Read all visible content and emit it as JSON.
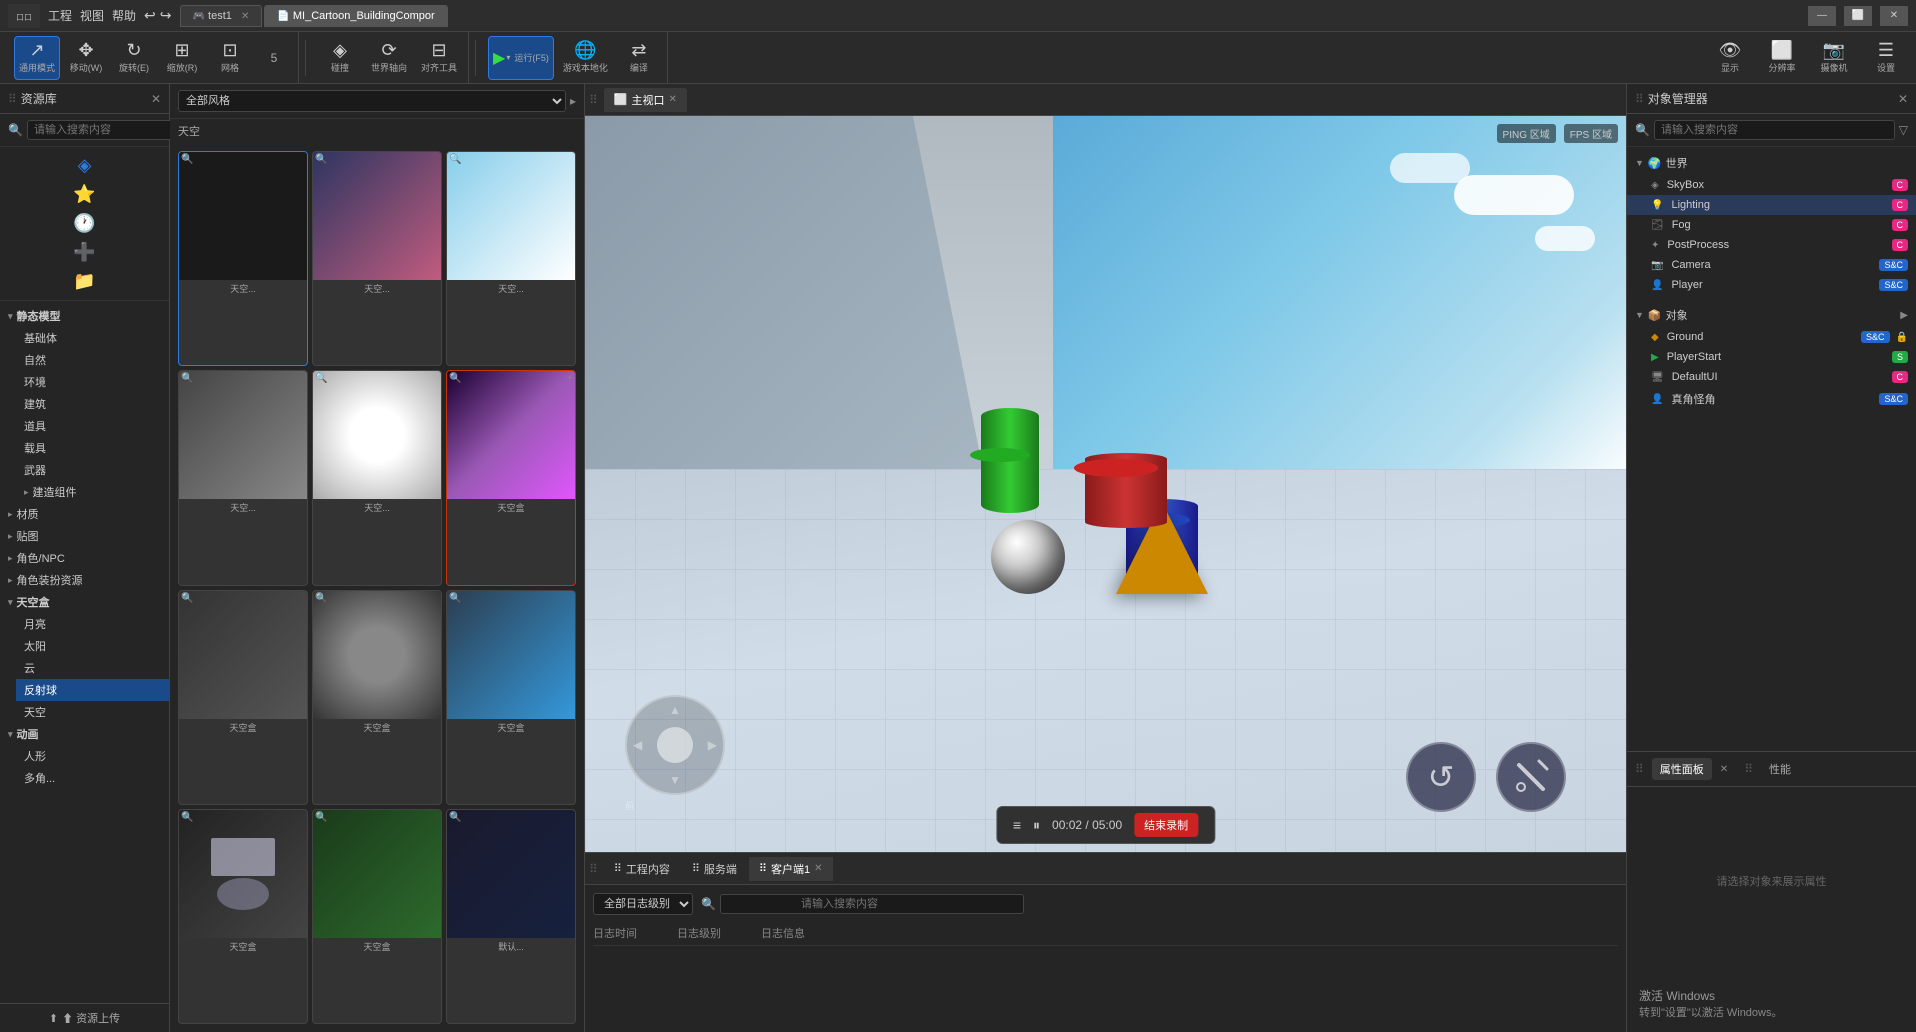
{
  "titlebar": {
    "logo": "LOGO",
    "tabs": [
      {
        "id": "tab1",
        "label": "test1",
        "icon": "🎮",
        "active": true
      },
      {
        "id": "tab2",
        "label": "MI_Cartoon_BuildingCompor",
        "icon": "📄",
        "active": false
      }
    ],
    "win_controls": [
      "—",
      "⬜",
      "✕"
    ]
  },
  "toolbar": {
    "groups": [
      {
        "items": [
          {
            "id": "mode",
            "icon": "↗",
            "label": "通用模式",
            "active": true
          },
          {
            "id": "move",
            "icon": "✥",
            "label": "移动(W)"
          },
          {
            "id": "rotate",
            "icon": "↻",
            "label": "旋转(E)"
          },
          {
            "id": "scale",
            "icon": "⊞",
            "label": "缩放(R)"
          },
          {
            "id": "grid",
            "icon": "⊡",
            "label": "网格"
          },
          {
            "id": "step",
            "icon": "5",
            "label": ""
          }
        ]
      },
      {
        "items": [
          {
            "id": "collision",
            "icon": "◈",
            "label": "碰撞"
          },
          {
            "id": "worldaxis",
            "icon": "⟳",
            "label": "世界轴向"
          },
          {
            "id": "align",
            "icon": "⊟",
            "label": "对齐工具"
          }
        ]
      },
      {
        "items": [
          {
            "id": "run",
            "icon": "▶",
            "label": "运行(F5)",
            "active": true,
            "hasArrow": true
          },
          {
            "id": "localize",
            "icon": "🌐",
            "label": "游戏本地化"
          },
          {
            "id": "translate",
            "icon": "⇄",
            "label": "编译"
          }
        ]
      }
    ],
    "right_controls": [
      {
        "id": "display",
        "label": "显示"
      },
      {
        "id": "resolution",
        "label": "分辨率"
      },
      {
        "id": "camera",
        "label": "摄像机"
      },
      {
        "id": "settings",
        "label": "设置"
      }
    ]
  },
  "menus": [
    "工程",
    "视图",
    "帮助"
  ],
  "asset_panel": {
    "title": "资源库",
    "search_placeholder": "请输入搜索内容",
    "style_options": [
      "全部风格"
    ],
    "category_label": "天空",
    "tree": [
      {
        "label": "静态模型",
        "expanded": true,
        "isCategory": true
      },
      {
        "label": "基础体",
        "indent": true
      },
      {
        "label": "自然",
        "indent": true
      },
      {
        "label": "环境",
        "indent": true
      },
      {
        "label": "建筑",
        "indent": true
      },
      {
        "label": "道具",
        "indent": true
      },
      {
        "label": "载具",
        "indent": true
      },
      {
        "label": "武器",
        "indent": true
      },
      {
        "label": "建造组件",
        "indent": true,
        "expandable": true
      },
      {
        "label": "材质",
        "isCategory": true,
        "expandable": true
      },
      {
        "label": "贴图",
        "isCategory": true,
        "expandable": true
      },
      {
        "label": "角色/NPC",
        "isCategory": true,
        "expandable": true
      },
      {
        "label": "角色装扮资源",
        "isCategory": true,
        "expandable": true
      },
      {
        "label": "天空盒",
        "isCategory": true,
        "expanded": true
      },
      {
        "label": "月亮",
        "indent": true
      },
      {
        "label": "太阳",
        "indent": true
      },
      {
        "label": "云",
        "indent": true
      },
      {
        "label": "反射球",
        "indent": true,
        "active": true
      },
      {
        "label": "天空",
        "indent": true
      },
      {
        "label": "动画",
        "isCategory": true,
        "expanded": true
      },
      {
        "label": "人形",
        "indent": true
      },
      {
        "label": "多角...",
        "indent": true
      }
    ],
    "upload_label": "⬆ 资源上传",
    "thumbnails": [
      {
        "label": "天空...",
        "style": "sky-thumb-selected",
        "selected": true
      },
      {
        "label": "天空...",
        "style": "sky-thumb-2"
      },
      {
        "label": "天空...",
        "style": "sky-thumb-3"
      },
      {
        "label": "天空...",
        "style": "sky-thumb-4"
      },
      {
        "label": "天空...",
        "style": "sky-thumb-5"
      },
      {
        "label": "天空盒",
        "style": "sky-thumb-special"
      },
      {
        "label": "天空盒",
        "style": "sky-thumb-4"
      },
      {
        "label": "天空盒",
        "style": "sky-thumb-5"
      },
      {
        "label": "天空盒",
        "style": "sky-thumb-3"
      },
      {
        "label": "天空盒",
        "style": "sky-thumb-2"
      },
      {
        "label": "天空盒",
        "style": "sky-thumb-6"
      },
      {
        "label": "默认...",
        "style": "sky-thumb-1"
      }
    ]
  },
  "viewport": {
    "tab_label": "主视口",
    "ping_label": "PING 区域",
    "fps_label": "FPS 区域",
    "joystick_arrows": "↑↓←→",
    "action_btns": [
      "↺",
      "⚔"
    ]
  },
  "bottom_panel": {
    "tabs": [
      {
        "label": "工程内容",
        "active": false
      },
      {
        "label": "服务端",
        "active": false
      },
      {
        "label": "客户端1",
        "active": true,
        "closable": true
      }
    ],
    "log_filter": "全部日志级别",
    "search_placeholder": "请输入搜索内容",
    "headers": [
      "日志时间",
      "日志级别",
      "日志信息"
    ],
    "recording": {
      "time": "00:02 / 05:00",
      "stop_label": "结束录制"
    }
  },
  "object_manager": {
    "title": "对象管理器",
    "search_placeholder": "请输入搜索内容",
    "world_label": "世界",
    "object_label": "对象",
    "world_items": [
      {
        "label": "SkyBox",
        "badge": "C",
        "badge_type": "badge-c"
      },
      {
        "label": "Lighting",
        "badge": "C",
        "badge_type": "badge-c"
      },
      {
        "label": "Fog",
        "badge": "C",
        "badge_type": "badge-c"
      },
      {
        "label": "PostProcess",
        "badge": "C",
        "badge_type": "badge-c"
      },
      {
        "label": "Camera",
        "badge": "S&C",
        "badge_type": "badge-sc"
      },
      {
        "label": "Player",
        "badge": "S&C",
        "badge_type": "badge-sc"
      }
    ],
    "object_items": [
      {
        "label": "Ground",
        "badge": "S&C",
        "badge_type": "badge-sc",
        "hasLock": true
      },
      {
        "label": "PlayerStart",
        "badge": "S",
        "badge_type": "badge-s"
      },
      {
        "label": "DefaultUI",
        "badge": "C",
        "badge_type": "badge-c"
      },
      {
        "label": "真角怪角",
        "badge": "S&C",
        "badge_type": "badge-sc"
      }
    ]
  },
  "properties_panel": {
    "title": "属性面板",
    "tabs": [
      "属性面板",
      "性能"
    ],
    "empty_message": "请选择对象来展示属性"
  },
  "win_activation": {
    "title": "激活 Windows",
    "subtitle": "转到\"设置\"以激活 Windows。"
  }
}
